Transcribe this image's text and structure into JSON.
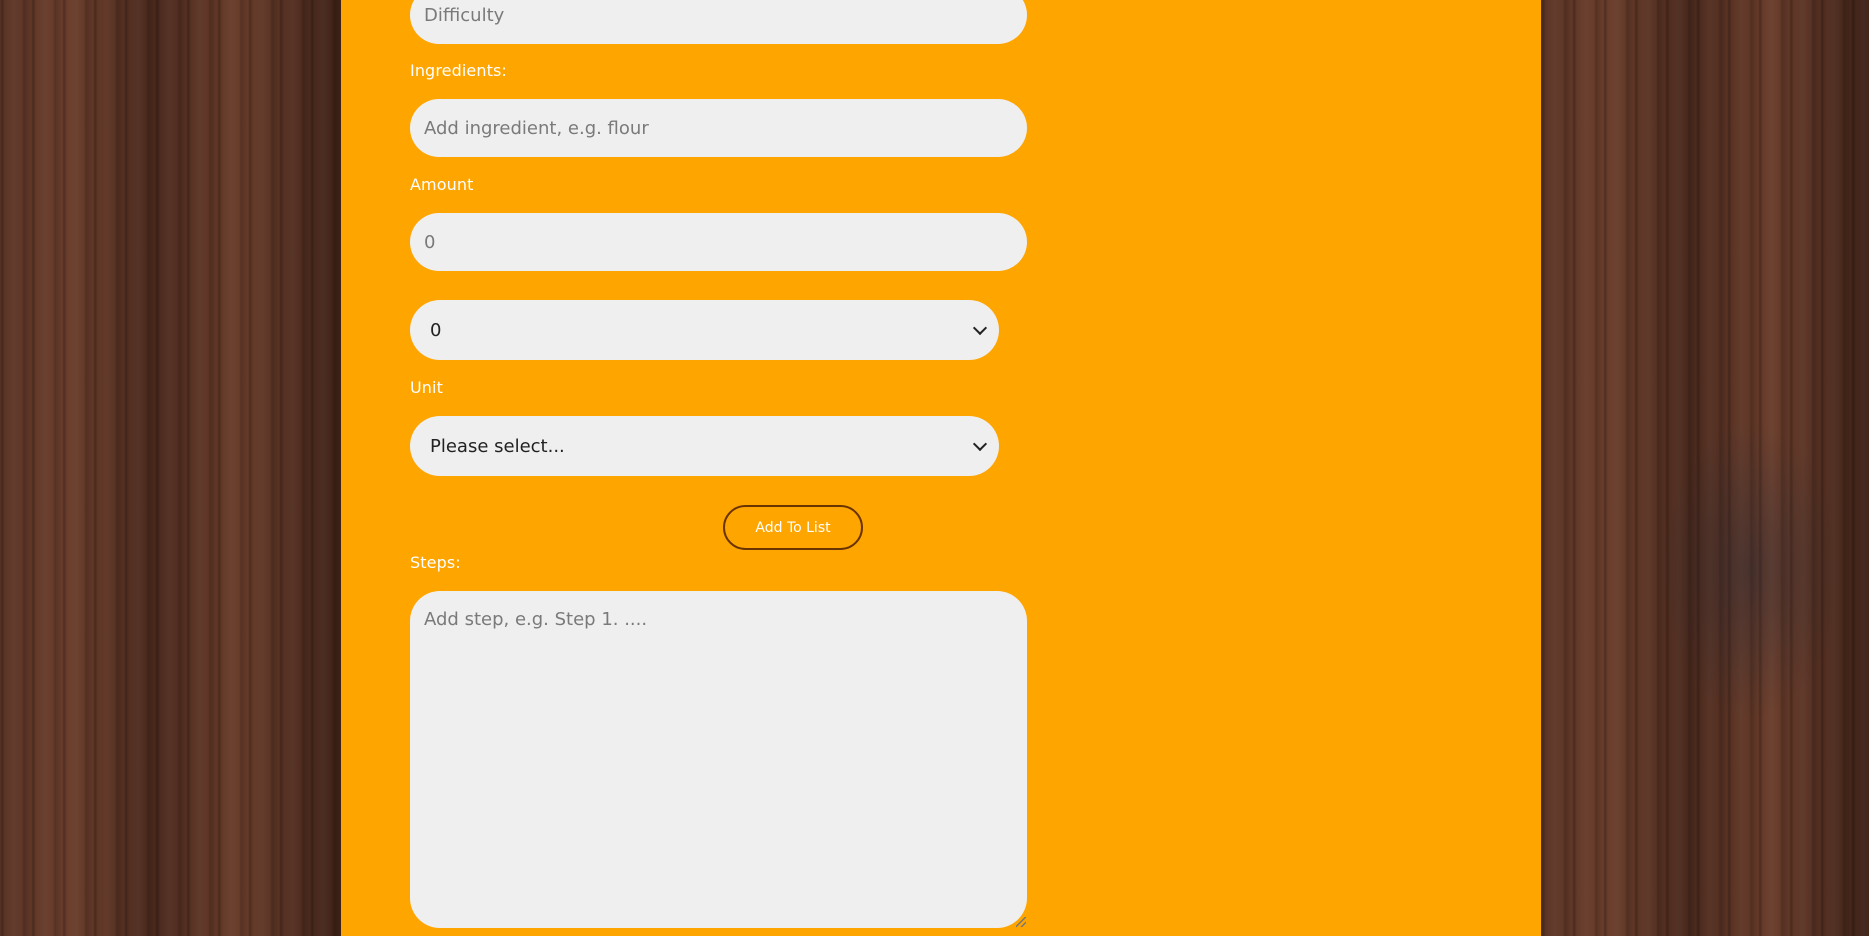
{
  "form": {
    "difficulty": {
      "placeholder": "Difficulty",
      "value": ""
    },
    "ingredients": {
      "label": "Ingredients:",
      "placeholder": "Add ingredient, e.g. flour",
      "value": ""
    },
    "amount": {
      "label": "Amount",
      "placeholder": "0",
      "value": ""
    },
    "amount_select": {
      "selected": "0"
    },
    "unit": {
      "label": "Unit",
      "selected": "Please select..."
    },
    "add_to_list_label": "Add To List",
    "steps": {
      "label": "Steps:",
      "placeholder": "Add step, e.g. Step 1. ....",
      "value": ""
    }
  },
  "colors": {
    "panel": "#ffa500",
    "field_bg": "#efefef",
    "label_text": "#ffffff",
    "button_border": "#6a3400"
  },
  "icons": {
    "select_arrow": "chevron-down-icon",
    "textarea_resize": "resize-grip-icon"
  }
}
